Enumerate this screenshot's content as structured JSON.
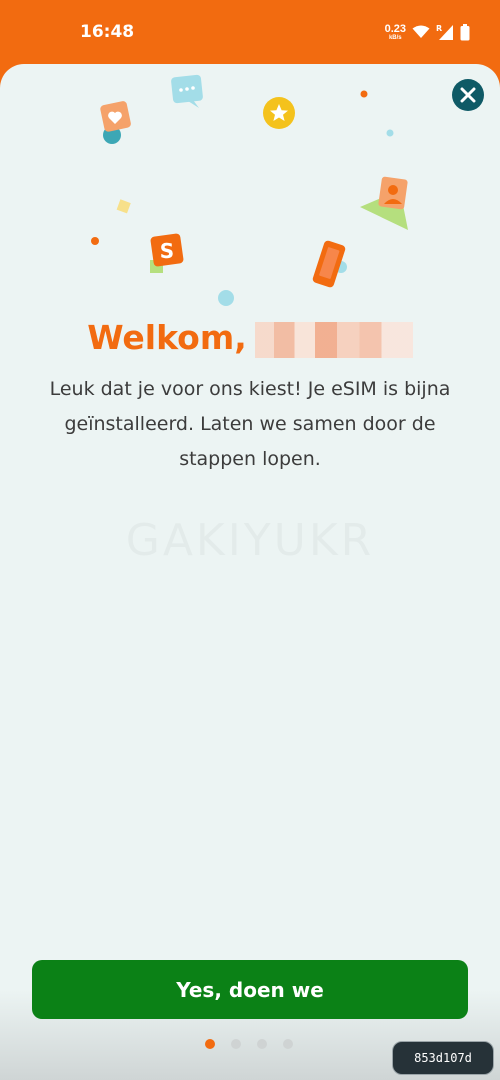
{
  "status_bar": {
    "time": "16:48",
    "net_speed_value": "0.23",
    "net_speed_unit": "kB/s",
    "roaming_letter": "R",
    "icons": [
      "wifi-icon",
      "signal-icon",
      "battery-icon"
    ]
  },
  "illustration_icons": [
    "heart-icon",
    "chat-bubble-icon",
    "star-icon",
    "person-card-icon",
    "s-logo-icon",
    "phone-icon"
  ],
  "welcome": {
    "title": "Welkom,"
  },
  "intro": {
    "text": "Leuk dat je voor ons kiest! Je eSIM is bijna geïnstalleerd. Laten we samen door de stappen lopen."
  },
  "watermark_text": "GAKIYUKR",
  "primary_button": {
    "label": "Yes, doen we"
  },
  "pagination": {
    "total": 4,
    "current": 1
  },
  "badge": {
    "hash": "853d107d"
  },
  "colors": {
    "brand_orange": "#f26b10",
    "sheet_bg": "#ecf4f3",
    "button_green": "#0b8116",
    "close_teal": "#0f5a66"
  }
}
